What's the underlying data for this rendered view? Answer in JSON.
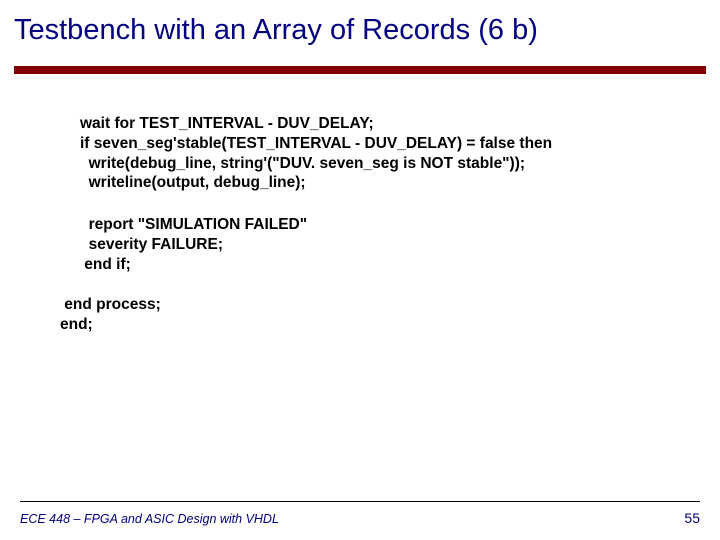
{
  "title": "Testbench with an Array of Records (6 b)",
  "code": {
    "block1": "wait for TEST_INTERVAL - DUV_DELAY;\nif seven_seg'stable(TEST_INTERVAL - DUV_DELAY) = false then\n  write(debug_line, string'(\"DUV. seven_seg is NOT stable\"));\n  writeline(output, debug_line);",
    "block2": "  report \"SIMULATION FAILED\"\n  severity FAILURE;\n end if;",
    "block3": " end process;\nend;"
  },
  "footer": {
    "left": "ECE 448 – FPGA and ASIC Design with VHDL",
    "right": "55"
  }
}
